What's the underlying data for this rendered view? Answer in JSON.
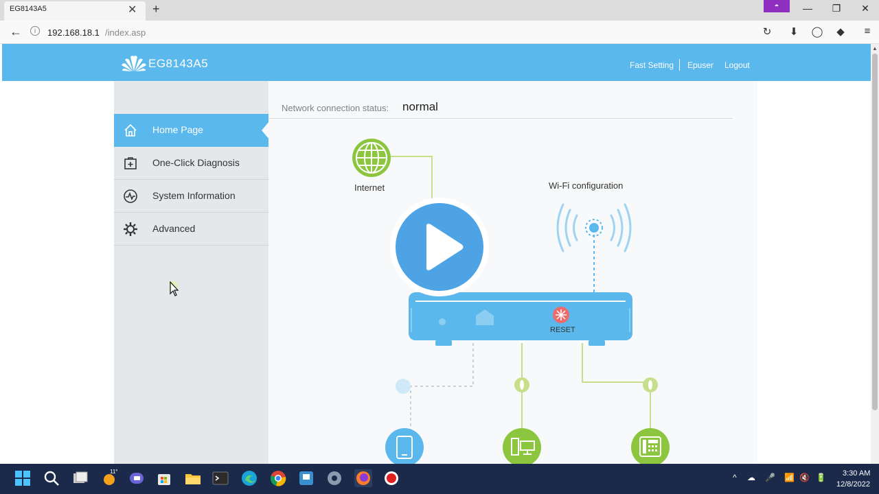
{
  "browser": {
    "tab_title": "EG8143A5",
    "tab_close": "✕",
    "new_tab": "+",
    "private_badge": "◓",
    "minimize": "—",
    "restore": "❐",
    "close": "✕",
    "back": "←",
    "info": "i",
    "url_host": "192.168.18.1",
    "url_path": "/index.asp",
    "reload": "↻",
    "download": "⬇",
    "account": "◯",
    "pocket": "◆",
    "menu": "≡"
  },
  "header": {
    "brand": "EG8143A5",
    "links": {
      "fast_setting": "Fast Setting",
      "user": "Epuser",
      "logout": "Logout"
    },
    "color": "#5bb8ec"
  },
  "sidebar": {
    "items": [
      {
        "label": "Home Page",
        "icon": "home-icon",
        "active": true
      },
      {
        "label": "One-Click Diagnosis",
        "icon": "medkit-icon"
      },
      {
        "label": "System Information",
        "icon": "pulse-icon"
      },
      {
        "label": "Advanced",
        "icon": "gear-icon"
      }
    ]
  },
  "main": {
    "status_label": "Network connection status:",
    "status_value": "normal",
    "internet_label": "Internet",
    "wifi_label": "Wi-Fi configuration",
    "reset_label": "RESET",
    "device_icons": [
      "globe-icon",
      "wifi-signal-icon",
      "router-icon",
      "tablet-icon",
      "computer-icon",
      "phone-icon"
    ],
    "accent_green": "#8cc63f",
    "accent_blue": "#5bb8ec"
  },
  "overlay": {
    "icon": "play-button-icon"
  },
  "taskbar": {
    "weather": "11°",
    "apps": [
      "windows-start-icon",
      "search-icon",
      "task-view-icon",
      "weather-icon",
      "teams-icon",
      "store-icon",
      "file-explorer-icon",
      "terminal-icon",
      "edge-icon",
      "chrome-icon",
      "remote-icon",
      "settings-icon",
      "firefox-icon",
      "record-icon"
    ],
    "tray": {
      "chevron": "^",
      "cloud": "☁",
      "mic": "🎤",
      "wifi": "📶",
      "sound": "🔇",
      "battery": "🔋"
    },
    "time": "3:30 AM",
    "date": "12/8/2022"
  }
}
